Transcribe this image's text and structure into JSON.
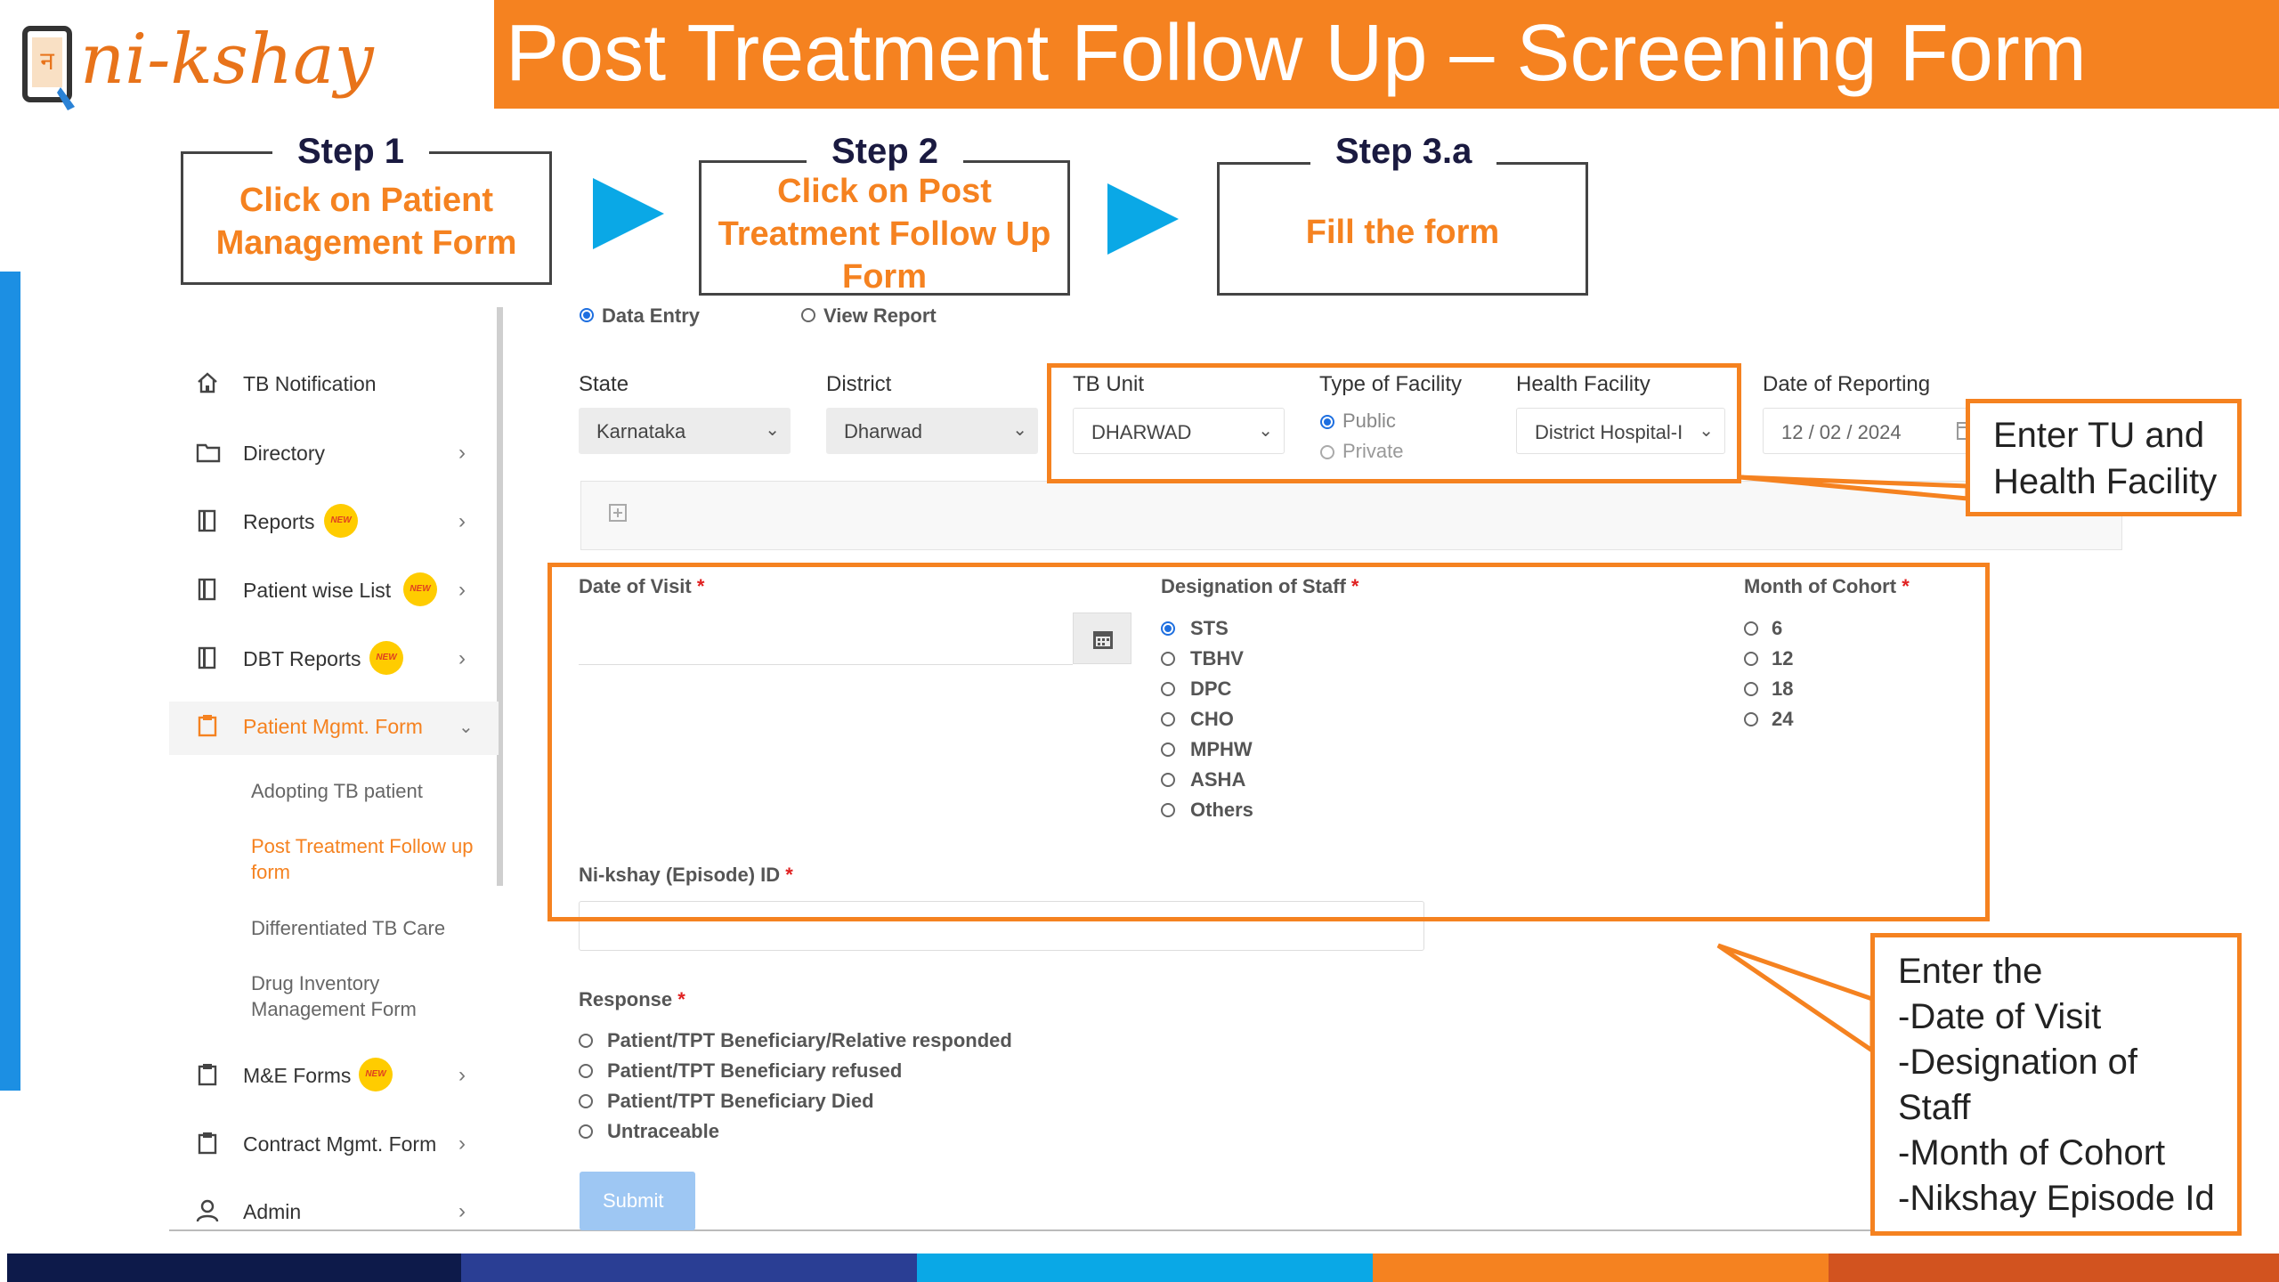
{
  "header": {
    "logo_text": "ni-kshay",
    "title": "Post Treatment Follow Up – Screening Form"
  },
  "steps": [
    {
      "title": "Step 1",
      "body": [
        "Click on Patient",
        "Management Form"
      ]
    },
    {
      "title": "Step 2",
      "body": [
        "Click on Post",
        "Treatment Follow Up",
        "Form"
      ]
    },
    {
      "title": "Step 3.a",
      "body": [
        "Fill the form"
      ]
    }
  ],
  "mode": {
    "data_entry": "Data Entry",
    "view_report": "View Report",
    "selected": "Data Entry"
  },
  "sidebar": {
    "items": [
      {
        "label": "TB Notification",
        "icon": "home-icon"
      },
      {
        "label": "Directory",
        "icon": "folder-icon"
      },
      {
        "label": "Reports",
        "icon": "document-icon",
        "badge": "NEW"
      },
      {
        "label": "Patient wise List",
        "icon": "document-icon",
        "badge": "NEW"
      },
      {
        "label": "DBT Reports",
        "icon": "document-icon",
        "badge": "NEW"
      },
      {
        "label": "Patient Mgmt. Form",
        "icon": "clipboard-icon"
      },
      {
        "label": "M&E Forms",
        "icon": "clipboard-icon",
        "badge": "NEW"
      },
      {
        "label": "Contract Mgmt. Form",
        "icon": "clipboard-icon"
      },
      {
        "label": "Admin",
        "icon": "user-icon"
      }
    ],
    "sub_items": [
      {
        "label": "Adopting TB patient"
      },
      {
        "label": "Post Treatment Follow up form"
      },
      {
        "label": "Differentiated TB Care"
      },
      {
        "label": "Drug Inventory Management Form"
      }
    ]
  },
  "filters": {
    "state_label": "State",
    "state_value": "Karnataka",
    "district_label": "District",
    "district_value": "Dharwad",
    "tb_unit_label": "TB Unit",
    "tb_unit_value": "DHARWAD",
    "facility_type_label": "Type of Facility",
    "facility_type_options": [
      "Public",
      "Private"
    ],
    "facility_type_selected": "Public",
    "health_facility_label": "Health Facility",
    "health_facility_value": "District Hospital-I",
    "date_label": "Date of Reporting",
    "date_value": "12 / 02 / 2024"
  },
  "form": {
    "date_of_visit_label": "Date of Visit",
    "designation_label": "Designation of Staff",
    "designation_options": [
      "STS",
      "TBHV",
      "DPC",
      "CHO",
      "MPHW",
      "ASHA",
      "Others"
    ],
    "designation_selected": "STS",
    "cohort_label": "Month of Cohort",
    "cohort_options": [
      "6",
      "12",
      "18",
      "24"
    ],
    "episode_label": "Ni-kshay (Episode) ID",
    "response_label": "Response",
    "response_options": [
      "Patient/TPT Beneficiary/Relative responded",
      "Patient/TPT Beneficiary refused",
      "Patient/TPT Beneficiary Died",
      "Untraceable"
    ],
    "submit_label": "Submit",
    "required_mark": "*"
  },
  "callouts": {
    "tu": [
      "Enter TU and",
      "Health Facility"
    ],
    "form": [
      "Enter the",
      "-Date of Visit",
      "-Designation of",
      "Staff",
      "-Month of Cohort",
      "-Nikshay Episode Id"
    ]
  },
  "colors": {
    "brand_orange": "#f58220",
    "arrow_blue": "#0aa8e6",
    "accent_blue": "#1c8fe3",
    "bottom_bar": [
      "#0d1a4a",
      "#2a3e94",
      "#0aa8e6",
      "#f58220",
      "#d2531f"
    ]
  }
}
